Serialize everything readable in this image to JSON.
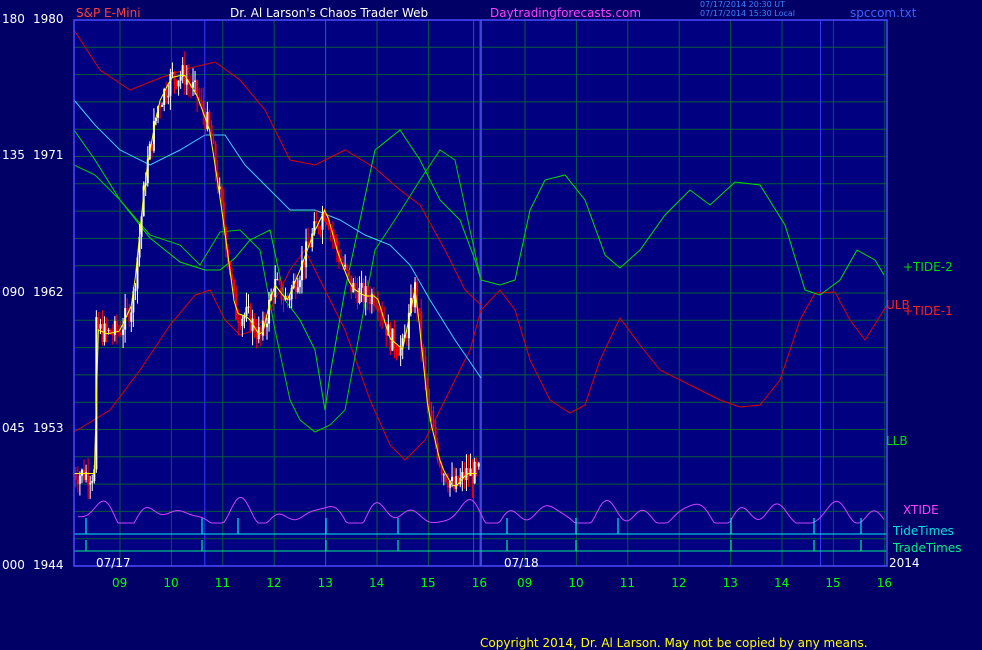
{
  "header": {
    "instrument": "S&P E-Mini",
    "title": "Dr. Al Larson's Chaos Trader Web",
    "site": "Daytradingforecasts.com",
    "timestamp_ut": "07/17/2014 20:30 UT",
    "timestamp_local": "07/17/2014 15:30 Local",
    "filename": "spccom.txt"
  },
  "footer": {
    "copyright": "Copyright 2014, Dr. Al Larson. May not be copied by any means."
  },
  "axes": {
    "y_left_labels": [
      "180",
      "135",
      "090",
      "045",
      "000"
    ],
    "y_right_labels": [
      "1980",
      "1971",
      "1962",
      "1953",
      "1944"
    ],
    "x_hours": [
      "09",
      "10",
      "11",
      "12",
      "13",
      "14",
      "15",
      "16",
      "09",
      "10",
      "11",
      "12",
      "13",
      "14",
      "15",
      "16"
    ],
    "date_left": "07/17",
    "date_mid": "07/18",
    "year": "2014"
  },
  "legend": {
    "tide2": "+TIDE-2",
    "ulb": "ULB",
    "tide1": "+TIDE-1",
    "llb": "LLB",
    "xtide": "XTIDE",
    "tidetimes": "TideTimes",
    "tradetimes": "TradeTimes"
  },
  "colors": {
    "background": "#000066",
    "plot_bg": "#000080",
    "grid": "#0a5a3a",
    "frame": "#4a4aff",
    "price_up": "#ffffff",
    "price_down": "#ff0000",
    "tide2": "#00dd00",
    "ulb": "#dd0000",
    "llb_tide": "#00cc00",
    "xtide": "#cc44ff",
    "tidetimes": "#00eeee",
    "tradetimes": "#00ee88",
    "ma_fast": "#ffff00",
    "ma_slow": "#44ccff"
  },
  "chart_data": {
    "type": "line",
    "title": "S&P E-Mini",
    "y_range_price": [
      1944,
      1980
    ],
    "y_range_tide": [
      0,
      180
    ],
    "x_days": [
      "07/17",
      "07/18"
    ],
    "session_hours": [
      9,
      10,
      11,
      12,
      13,
      14,
      15,
      16
    ],
    "price_close_0717": [
      [
        8.5,
        1959.7
      ],
      [
        8.75,
        1959.3
      ],
      [
        9.0,
        1959.5
      ],
      [
        9.25,
        1961.4
      ],
      [
        9.5,
        1969.8
      ],
      [
        9.75,
        1974.5
      ],
      [
        10.0,
        1976.2
      ],
      [
        10.25,
        1976.4
      ],
      [
        10.5,
        1975.0
      ],
      [
        10.75,
        1972.7
      ],
      [
        11.0,
        1967.0
      ],
      [
        11.25,
        1960.7
      ],
      [
        11.5,
        1960.4
      ],
      [
        11.75,
        1959.0
      ],
      [
        12.0,
        1962.6
      ],
      [
        12.25,
        1961.5
      ],
      [
        12.5,
        1963.5
      ],
      [
        12.75,
        1965.8
      ],
      [
        13.0,
        1967.6
      ],
      [
        13.25,
        1964.5
      ],
      [
        13.5,
        1962.4
      ],
      [
        13.75,
        1961.8
      ],
      [
        14.0,
        1961.8
      ],
      [
        14.25,
        1959.0
      ],
      [
        14.5,
        1958.3
      ],
      [
        14.75,
        1962.4
      ],
      [
        15.0,
        1954.1
      ],
      [
        15.25,
        1950.6
      ],
      [
        15.5,
        1949.1
      ],
      [
        15.75,
        1950.1
      ]
    ],
    "series": [
      {
        "name": "+TIDE-2"
      },
      {
        "name": "+TIDE-1"
      },
      {
        "name": "ULB"
      },
      {
        "name": "LLB"
      },
      {
        "name": "XTIDE"
      },
      {
        "name": "TideTimes"
      },
      {
        "name": "TradeTimes"
      }
    ],
    "grid": true
  }
}
